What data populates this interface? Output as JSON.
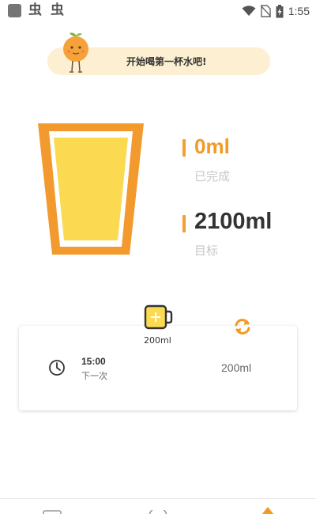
{
  "status_bar": {
    "app_icon": "square-app-icon",
    "bug_icon_1": "虫",
    "bug_icon_2": "虫",
    "icons": [
      "wifi-icon",
      "no-sim-icon",
      "battery-charging-icon"
    ],
    "time": "1:55"
  },
  "banner": {
    "text": "开始喝第一杯水吧!",
    "mascot": "orange-mascot-icon",
    "color": "#fdf0d2"
  },
  "cup": {
    "fill_color": "#fbda52",
    "border_color": "#f39a2e"
  },
  "stats": {
    "done_value": "0ml",
    "done_label": "已完成",
    "goal_value": "2100ml",
    "goal_label": "目标",
    "accent": "#f29a27"
  },
  "card": {
    "cup_size": "200ml",
    "next_time": "15:00",
    "next_label": "下一次",
    "next_amount": "200ml",
    "icons": [
      "mug-add-icon",
      "refresh-icon",
      "clock-icon"
    ]
  },
  "bottom_nav": {
    "items": [
      "record-tab-icon",
      "stats-tab-icon",
      "drink-tab-icon"
    ]
  }
}
